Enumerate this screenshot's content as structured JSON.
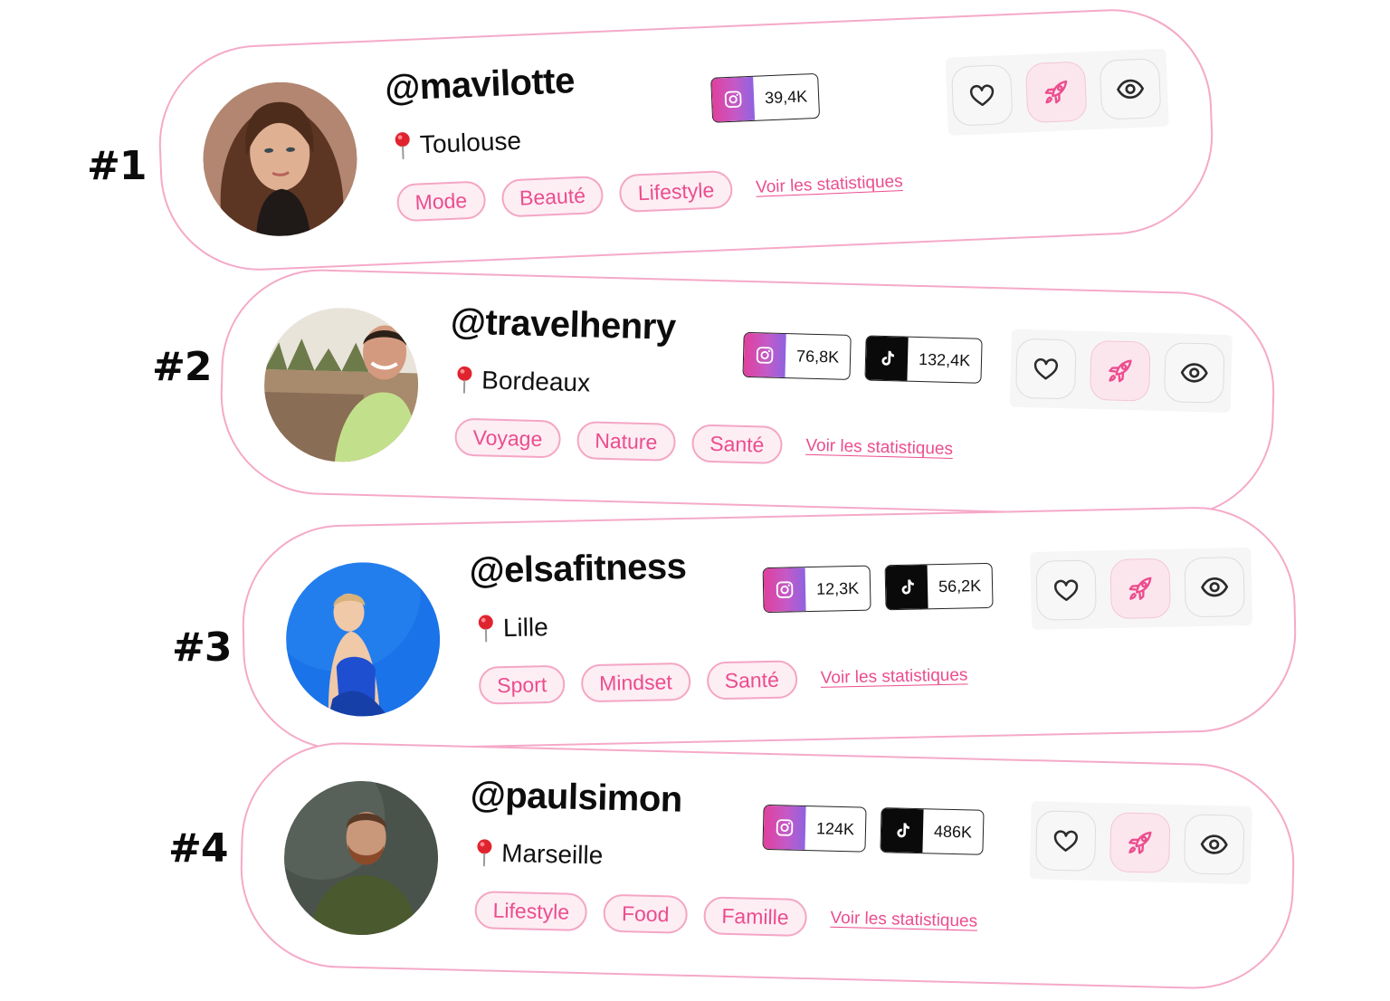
{
  "colors": {
    "accent": "#ec4d8e",
    "card_border": "#f5a9c8",
    "tag_background": "#fdeef4",
    "tiktok": "#0a0a0a"
  },
  "icons": {
    "location": "round-pushpin-icon",
    "instagram": "instagram-icon",
    "tiktok": "tiktok-icon",
    "favorite": "heart-icon",
    "boost": "rocket-icon",
    "view": "eye-icon"
  },
  "influencers": [
    {
      "rank": "#1",
      "handle": "@mavilotte",
      "location": "Toulouse",
      "tags": [
        "Mode",
        "Beauté",
        "Lifestyle"
      ],
      "stats_link": "Voir les statistiques",
      "instagram": "39,4K",
      "tiktok": ""
    },
    {
      "rank": "#2",
      "handle": "@travelhenry",
      "location": "Bordeaux",
      "tags": [
        "Voyage",
        "Nature",
        "Santé"
      ],
      "stats_link": "Voir les statistiques",
      "instagram": "76,8K",
      "tiktok": "132,4K"
    },
    {
      "rank": "#3",
      "handle": "@elsafitness",
      "location": "Lille",
      "tags": [
        "Sport",
        "Mindset",
        "Santé"
      ],
      "stats_link": "Voir les statistiques",
      "instagram": "12,3K",
      "tiktok": "56,2K"
    },
    {
      "rank": "#4",
      "handle": "@paulsimon",
      "location": "Marseille",
      "tags": [
        "Lifestyle",
        "Food",
        "Famille"
      ],
      "stats_link": "Voir les statistiques",
      "instagram": "124K",
      "tiktok": "486K"
    }
  ]
}
